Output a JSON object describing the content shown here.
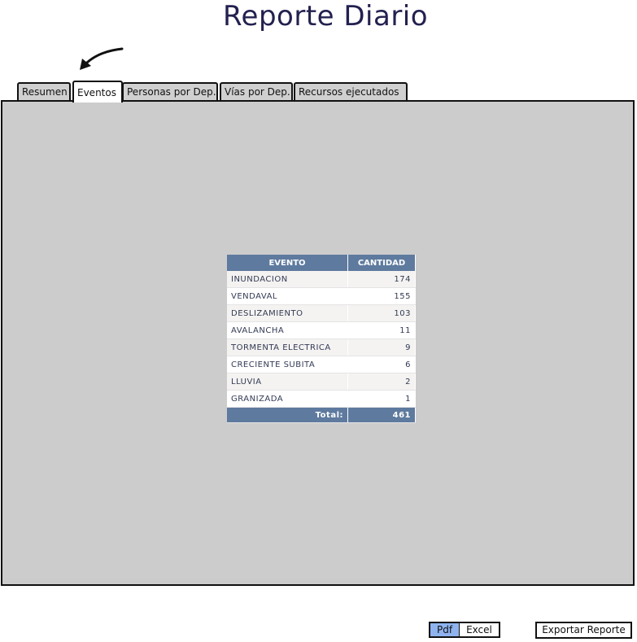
{
  "header": {
    "title": "Reporte Diario"
  },
  "tabs": [
    {
      "label": "Resumen"
    },
    {
      "label": "Eventos",
      "active": true
    },
    {
      "label": "Personas por Dep."
    },
    {
      "label": "Vías por Dep."
    },
    {
      "label": "Recursos ejecutados"
    }
  ],
  "table": {
    "columns": [
      "EVENTO",
      "CANTIDAD"
    ],
    "rows": [
      {
        "evento": "INUNDACION",
        "cantidad": "174"
      },
      {
        "evento": "VENDAVAL",
        "cantidad": "155"
      },
      {
        "evento": "DESLIZAMIENTO",
        "cantidad": "103"
      },
      {
        "evento": "AVALANCHA",
        "cantidad": "11"
      },
      {
        "evento": "TORMENTA ELECTRICA",
        "cantidad": "9"
      },
      {
        "evento": "CRECIENTE SUBITA",
        "cantidad": "6"
      },
      {
        "evento": "LLUVIA",
        "cantidad": "2"
      },
      {
        "evento": "GRANIZADA",
        "cantidad": "1"
      }
    ],
    "total_label": "Total:",
    "total_value": "461"
  },
  "export": {
    "formats": [
      {
        "label": "Pdf",
        "selected": true
      },
      {
        "label": "Excel",
        "selected": false
      }
    ],
    "button_label": "Exportar Reporte"
  },
  "colors": {
    "title": "#23214f",
    "table_header": "#5e7a9e",
    "selected_format": "#8fb3ef",
    "panel": "#cccccc"
  }
}
